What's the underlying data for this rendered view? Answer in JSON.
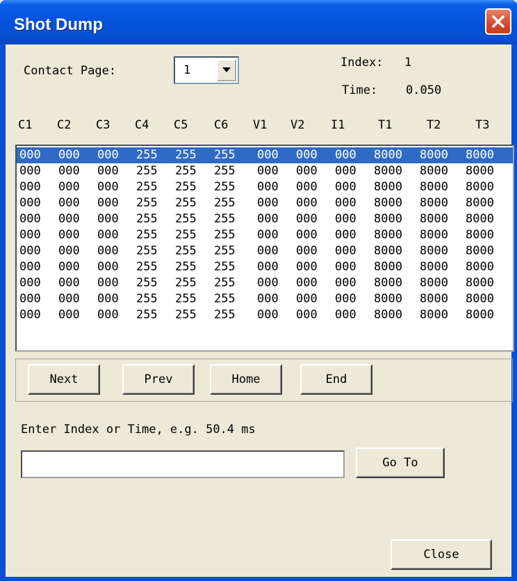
{
  "window": {
    "title": "Shot Dump"
  },
  "contact": {
    "label": "Contact Page:",
    "value": "1"
  },
  "info": {
    "index_label": "Index:",
    "index_value": "1",
    "time_label": "Time:",
    "time_value": "0.050"
  },
  "columns": [
    "C1",
    "C2",
    "C3",
    "C4",
    "C5",
    "C6",
    "V1",
    "V2",
    "I1",
    "T1",
    "T2",
    "T3"
  ],
  "rows": [
    [
      "000",
      "000",
      "000",
      "255",
      "255",
      "255",
      "000",
      "000",
      "000",
      "8000",
      "8000",
      "8000"
    ],
    [
      "000",
      "000",
      "000",
      "255",
      "255",
      "255",
      "000",
      "000",
      "000",
      "8000",
      "8000",
      "8000"
    ],
    [
      "000",
      "000",
      "000",
      "255",
      "255",
      "255",
      "000",
      "000",
      "000",
      "8000",
      "8000",
      "8000"
    ],
    [
      "000",
      "000",
      "000",
      "255",
      "255",
      "255",
      "000",
      "000",
      "000",
      "8000",
      "8000",
      "8000"
    ],
    [
      "000",
      "000",
      "000",
      "255",
      "255",
      "255",
      "000",
      "000",
      "000",
      "8000",
      "8000",
      "8000"
    ],
    [
      "000",
      "000",
      "000",
      "255",
      "255",
      "255",
      "000",
      "000",
      "000",
      "8000",
      "8000",
      "8000"
    ],
    [
      "000",
      "000",
      "000",
      "255",
      "255",
      "255",
      "000",
      "000",
      "000",
      "8000",
      "8000",
      "8000"
    ],
    [
      "000",
      "000",
      "000",
      "255",
      "255",
      "255",
      "000",
      "000",
      "000",
      "8000",
      "8000",
      "8000"
    ],
    [
      "000",
      "000",
      "000",
      "255",
      "255",
      "255",
      "000",
      "000",
      "000",
      "8000",
      "8000",
      "8000"
    ],
    [
      "000",
      "000",
      "000",
      "255",
      "255",
      "255",
      "000",
      "000",
      "000",
      "8000",
      "8000",
      "8000"
    ],
    [
      "000",
      "000",
      "000",
      "255",
      "255",
      "255",
      "000",
      "000",
      "000",
      "8000",
      "8000",
      "8000"
    ]
  ],
  "selected_row": 0,
  "nav": {
    "next": "Next",
    "prev": "Prev",
    "home": "Home",
    "end": "End"
  },
  "goto": {
    "prompt": "Enter Index or Time, e.g. 50.4 ms",
    "value": "",
    "button": "Go To"
  },
  "close_label": "Close",
  "colors": {
    "title_bar": "#0654dc",
    "selection": "#316ac5",
    "face": "#ece9d8"
  }
}
